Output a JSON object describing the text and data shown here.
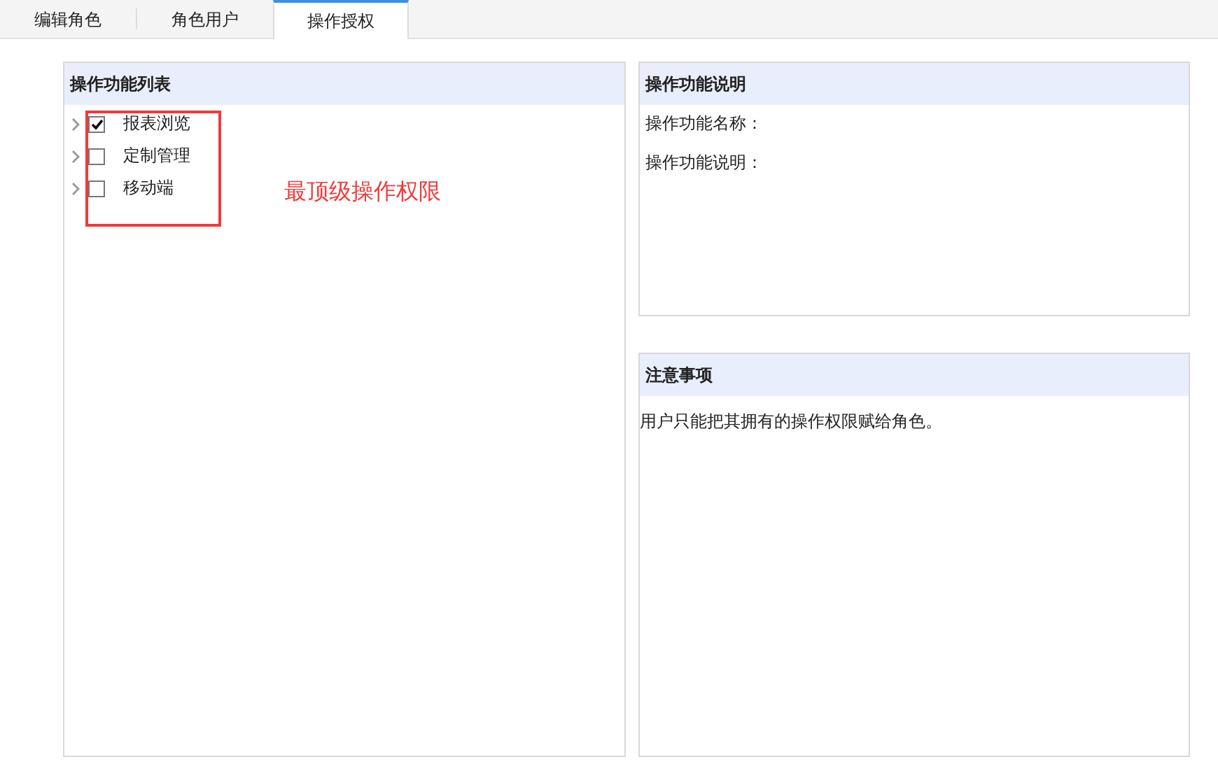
{
  "tabs": [
    {
      "label": "编辑角色",
      "selected": false
    },
    {
      "label": "角色用户",
      "selected": false
    },
    {
      "label": "操作授权",
      "selected": true
    }
  ],
  "function_list": {
    "title": "操作功能列表",
    "items": [
      {
        "label": "报表浏览",
        "checked": true,
        "expanded": false
      },
      {
        "label": "定制管理",
        "checked": false,
        "expanded": false
      },
      {
        "label": "移动端",
        "checked": false,
        "expanded": false
      }
    ]
  },
  "annotation": {
    "text": "最顶级操作权限"
  },
  "function_info": {
    "title": "操作功能说明",
    "fields": [
      "操作功能名称：",
      "操作功能说明："
    ]
  },
  "notes": {
    "title": "注意事项",
    "text": "用户只能把其拥有的操作权限赋给角色。"
  }
}
